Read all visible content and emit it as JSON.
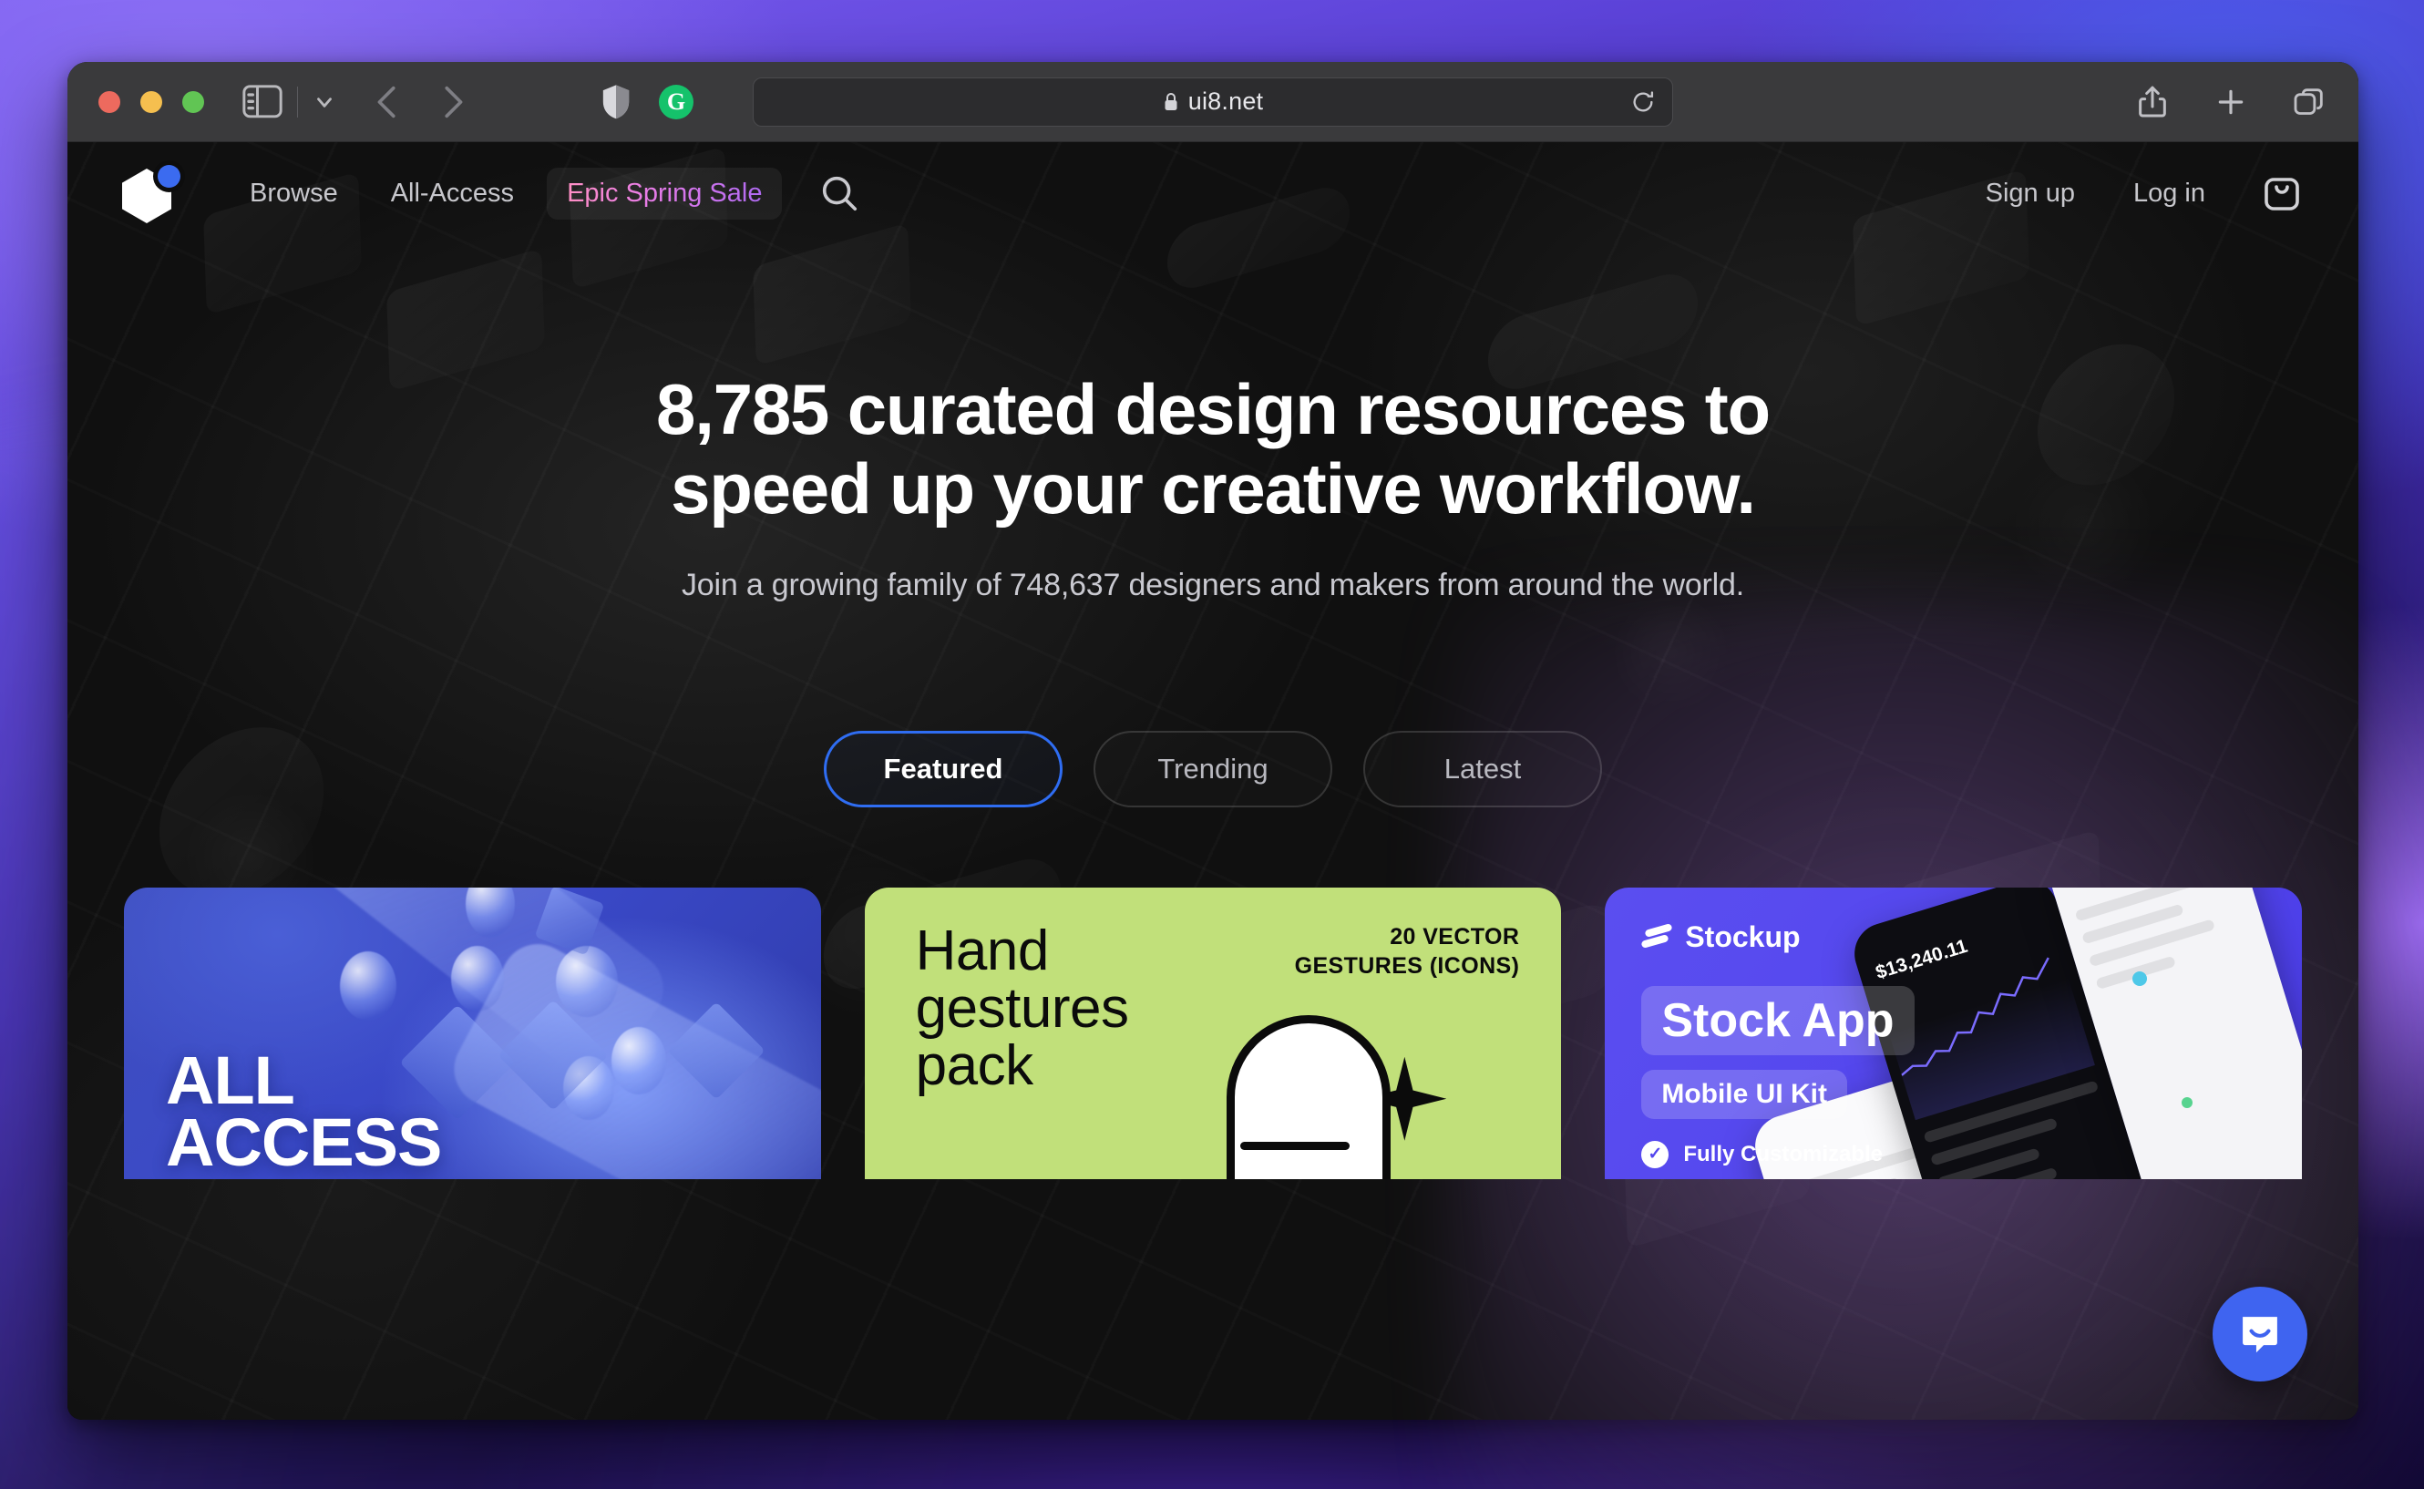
{
  "browser": {
    "url": "ui8.net",
    "lock_icon": "lock-icon",
    "reload_icon": "reload-icon",
    "sidebar_icon": "sidebar-toggle-icon",
    "chevron_icon": "chevron-down-icon",
    "back_icon": "back-arrow-icon",
    "forward_icon": "forward-arrow-icon",
    "shield_icon": "shield-privacy-icon",
    "grammarly_icon": "grammarly-icon",
    "grammarly_glyph": "G",
    "share_icon": "share-icon",
    "new_tab_icon": "plus-icon",
    "tab_overview_icon": "tab-overview-icon"
  },
  "site_nav": {
    "logo_name": "ui8-logo",
    "links": [
      {
        "label": "Browse",
        "name": "nav-browse"
      },
      {
        "label": "All-Access",
        "name": "nav-all-access"
      },
      {
        "label": "Epic Spring Sale",
        "name": "nav-epic-spring-sale"
      }
    ],
    "search_icon": "search-icon",
    "right_links": [
      {
        "label": "Sign up",
        "name": "nav-sign-up"
      },
      {
        "label": "Log in",
        "name": "nav-log-in"
      }
    ],
    "cart_icon": "shopping-bag-icon"
  },
  "hero": {
    "headline_line1": "8,785 curated design resources to",
    "headline_line2": "speed up your creative workflow.",
    "subtitle": "Join a growing family of 748,637 designers and makers from around the world.",
    "resource_count": "8,785",
    "member_count": "748,637"
  },
  "filters": {
    "tabs": [
      {
        "label": "Featured",
        "active": true
      },
      {
        "label": "Trending",
        "active": false
      },
      {
        "label": "Latest",
        "active": false
      }
    ]
  },
  "cards": [
    {
      "name": "card-all-access",
      "title": "ALL ACCESS",
      "title_line1": "ALL",
      "title_line2": "ACCESS"
    },
    {
      "name": "card-hand-gestures",
      "title_line1": "Hand",
      "title_line2": "gestures",
      "title_line3": "pack",
      "badge_line1": "20 VECTOR",
      "badge_line2": "GESTURES (ICONS)"
    },
    {
      "name": "card-stockup",
      "brand": "Stockup",
      "pill_primary": "Stock App",
      "pill_secondary": "Mobile UI Kit",
      "feature": "Fully Customizable",
      "check_glyph": "✓",
      "portfolio_value": "$13,240.11"
    }
  ],
  "chat": {
    "launcher_icon": "intercom-messenger-icon"
  },
  "colors": {
    "accent_blue": "#2f6df2",
    "logo_dot": "#3b6bf0",
    "sale_gradient_start": "#ff8fc4",
    "sale_gradient_end": "#b06af2",
    "card_allaccess": "#3a49c8",
    "card_gestures": "#c1e07a",
    "card_stockup": "#5346ee",
    "intercom": "#3f64f0"
  }
}
